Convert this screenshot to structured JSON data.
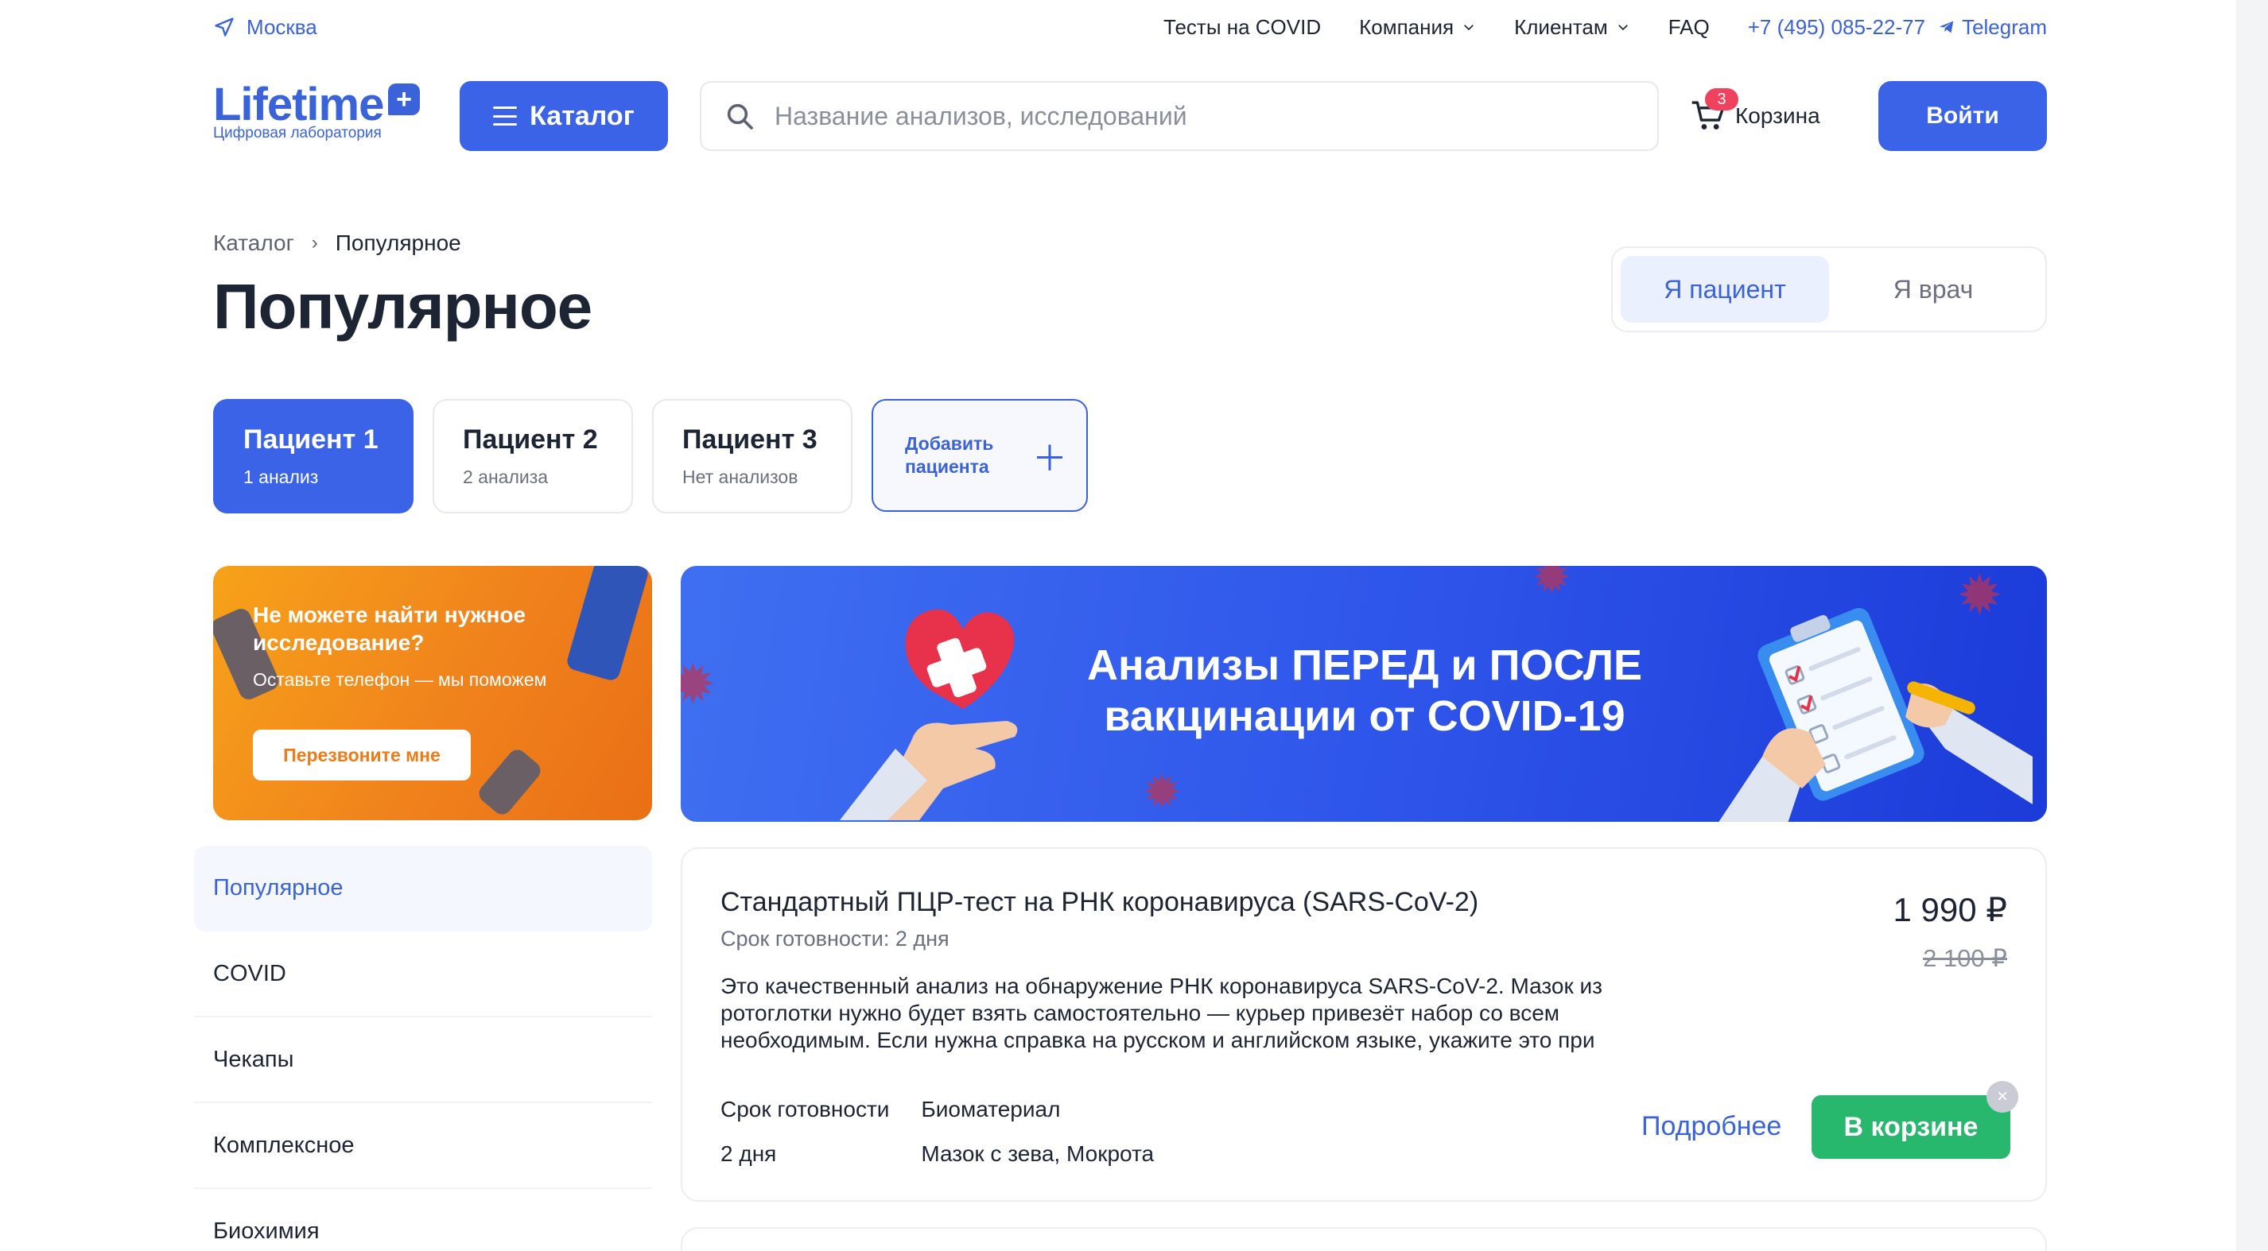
{
  "topbar": {
    "city": "Москва",
    "nav": [
      {
        "label": "Тесты на COVID",
        "dropdown": false
      },
      {
        "label": "Компания",
        "dropdown": true
      },
      {
        "label": "Клиентам",
        "dropdown": true
      },
      {
        "label": "FAQ",
        "dropdown": false
      }
    ],
    "phone": "+7 (495) 085-22-77",
    "telegram": "Telegram"
  },
  "header": {
    "logo_word": "Lifetime",
    "logo_plus": "+",
    "logo_tagline": "Цифровая лаборатория",
    "catalog_label": "Каталог",
    "search_placeholder": "Название анализов, исследований",
    "search_value": "",
    "cart_label": "Корзина",
    "cart_count": "3",
    "login_label": "Войти"
  },
  "breadcrumb": {
    "items": [
      "Каталог",
      "Популярное"
    ],
    "separator": "›"
  },
  "page_title": "Популярное",
  "role_switch": {
    "options": [
      "Я пациент",
      "Я врач"
    ],
    "selected": "Я пациент"
  },
  "patients": [
    {
      "name": "Пациент 1",
      "count": "1 анализ",
      "active": true
    },
    {
      "name": "Пациент 2",
      "count": "2 анализа",
      "active": false
    },
    {
      "name": "Пациент 3",
      "count": "Нет анализов",
      "active": false
    }
  ],
  "add_patient": {
    "label": "Добавить пациента",
    "icon": "plus-icon"
  },
  "promo": {
    "title": "Не можете найти нужное исследование?",
    "subtitle": "Оставьте телефон — мы поможем",
    "button": "Перезвоните мне"
  },
  "banner": {
    "text": "Анализы ПЕРЕД и ПОСЛЕ вакцинации от COVID-19"
  },
  "sidebar": {
    "items": [
      "Популярное",
      "COVID",
      "Чекапы",
      "Комплексное",
      "Биохимия"
    ],
    "active": "Популярное"
  },
  "product": {
    "title": "Стандартный ПЦР-тест на РНК коронавируса (SARS-CoV-2)",
    "ready": "Срок готовности: 2 дня",
    "description": "Это качественный анализ на обнаружение РНК коронавируса SARS-CoV-2. Мазок из ротоглотки нужно будет взять самостоятельно — курьер привезёт набор со всем необходимым. Если нужна справка на русском и английском языке, укажите это при",
    "price": "1 990 ₽",
    "old_price": "2 100 ₽",
    "meta": [
      {
        "label": "Срок готовности",
        "value": "2 дня"
      },
      {
        "label": "Биоматериал",
        "value": "Мазок с зева, Мокрота"
      }
    ],
    "more_label": "Подробнее",
    "in_cart_label": "В корзине",
    "remove_icon": "×"
  },
  "colors": {
    "brand_blue": "#3b63e8",
    "accent_green": "#27b86e",
    "badge_red": "#f0425f",
    "promo_orange": "#f0821c"
  }
}
